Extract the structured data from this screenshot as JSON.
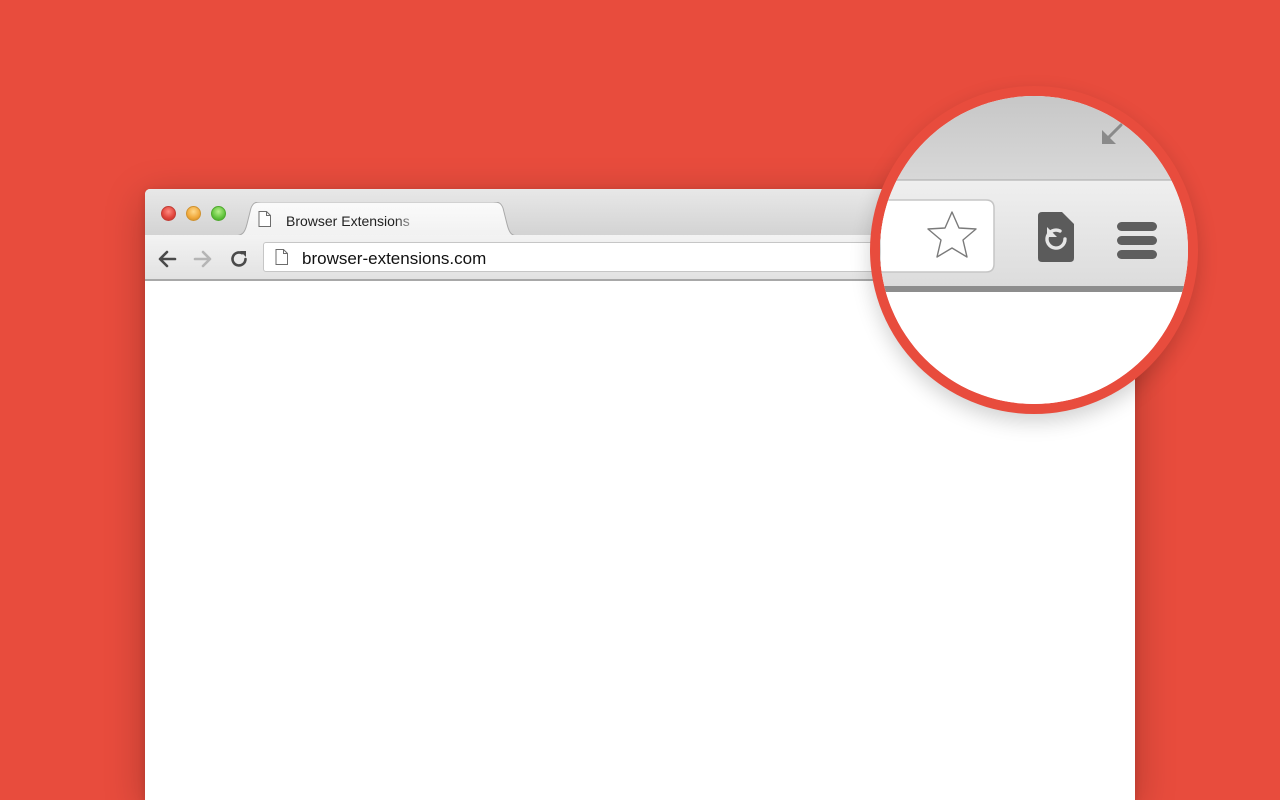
{
  "colors": {
    "background": "#E84C3D",
    "chrome_light": "#f3f3f3",
    "chrome_dark": "#d3d3d3",
    "icon_dark": "#5c5c5c"
  },
  "window": {
    "controls": [
      "close",
      "minimize",
      "maximize"
    ]
  },
  "tab": {
    "title": "Browser Extensions",
    "icon": "page-icon"
  },
  "toolbar": {
    "back_icon": "arrow-left-icon",
    "forward_icon": "arrow-right-icon",
    "reload_icon": "reload-icon"
  },
  "omnibox": {
    "url": "browser-extensions.com",
    "icon": "page-icon"
  },
  "magnifier": {
    "icons": [
      "star-icon",
      "extension-reload-icon",
      "menu-icon",
      "restore-icon"
    ]
  }
}
